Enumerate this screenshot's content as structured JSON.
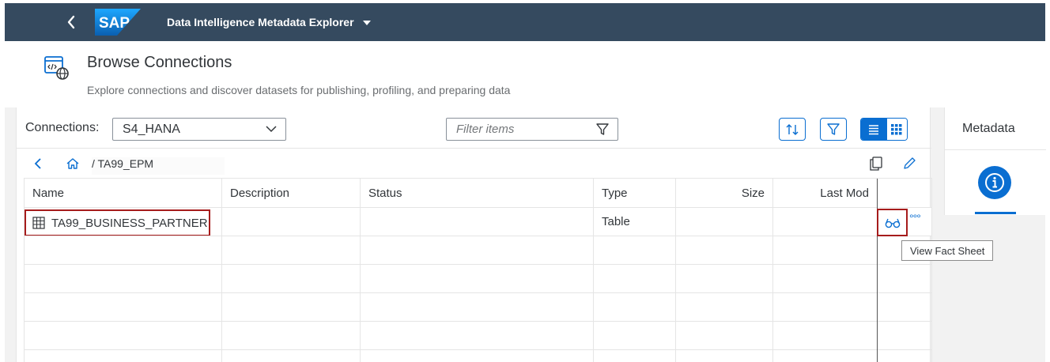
{
  "shell": {
    "app_title": "Data Intelligence Metadata Explorer",
    "logo_text": "SAP"
  },
  "header": {
    "title": "Browse Connections",
    "subtitle": "Explore connections and discover datasets for publishing, profiling, and preparing data"
  },
  "toolbar": {
    "connections_label": "Connections:",
    "connection_value": "S4_HANA",
    "filter_placeholder": "Filter items"
  },
  "breadcrumb": {
    "path": "/ TA99_EPM"
  },
  "table": {
    "columns": [
      "Name",
      "Description",
      "Status",
      "Type",
      "Size",
      "Last Mod"
    ],
    "rows": [
      {
        "name": "TA99_BUSINESS_PARTNER",
        "description": "",
        "status": "",
        "type": "Table",
        "size": "",
        "last_modified": ""
      }
    ]
  },
  "row_actions": {
    "tooltip": "View Fact Sheet",
    "more": "°°°"
  },
  "right_panel": {
    "title": "Metadata"
  },
  "colors": {
    "shell_bg": "#354a5f",
    "accent": "#0a6ed1",
    "highlight_border": "#a61c1c"
  }
}
